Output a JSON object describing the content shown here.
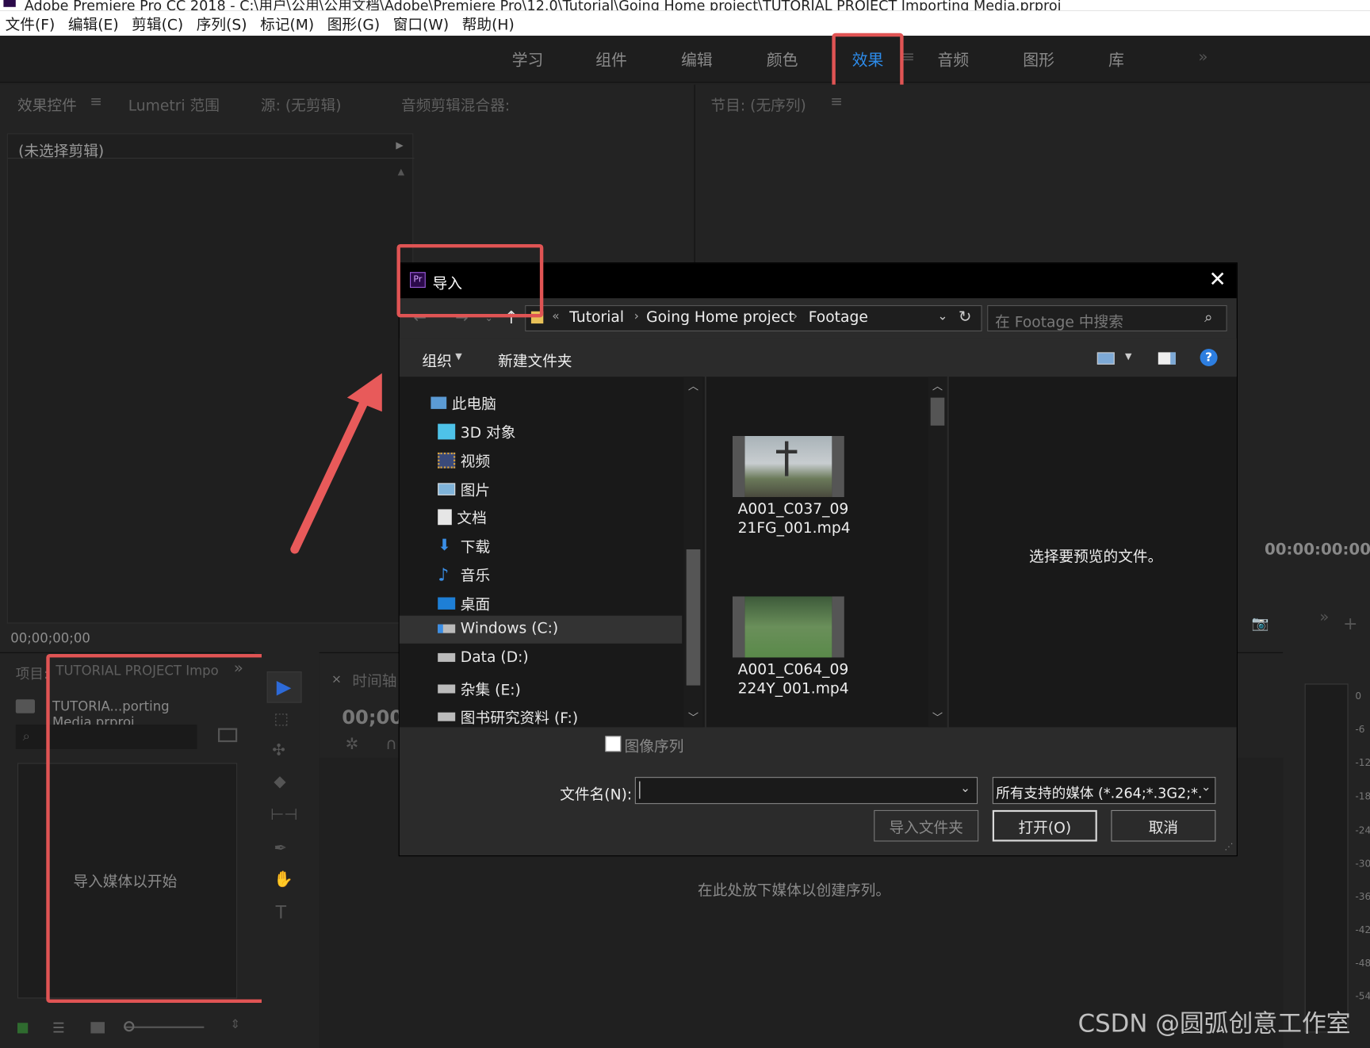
{
  "window": {
    "title": "Adobe Premiere Pro CC 2018 - C:\\用户\\公用\\公用文档\\Adobe\\Premiere Pro\\12.0\\Tutorial\\Going Home project\\TUTORIAL PROJECT Importing Media.prproj"
  },
  "menu": [
    "文件(F)",
    "编辑(E)",
    "剪辑(C)",
    "序列(S)",
    "标记(M)",
    "图形(G)",
    "窗口(W)",
    "帮助(H)"
  ],
  "workspaces": [
    "学习",
    "组件",
    "编辑",
    "颜色",
    "效果",
    "音频",
    "图形",
    "库"
  ],
  "workspaces_more": "»",
  "upper_left": {
    "tabs": [
      "效果控件",
      "Lumetri 范围",
      "源: (无剪辑)",
      "音频剪辑混合器:"
    ],
    "menu_glyph": "≡",
    "no_clip": "(未选择剪辑)",
    "timecode": "00;00;00;00"
  },
  "program": {
    "tab": "节目: (无序列)",
    "menu_glyph": "≡",
    "timecode": "00:00:00:00"
  },
  "project": {
    "tab_label": "项目:",
    "tab_title": "TUTORIAL PROJECT Impo",
    "file": "TUTORIA...porting Media.prproj",
    "empty": "导入媒体以开始"
  },
  "timeline": {
    "tab": "时间轴",
    "timecode": "00;00;",
    "drop_hint": "在此处放下媒体以创建序列。"
  },
  "meter_ticks": [
    "0",
    "-6",
    "-12",
    "-18",
    "-24",
    "-30",
    "-36",
    "-42",
    "-48",
    "-54"
  ],
  "dialog": {
    "app_badge": "Pr",
    "title": "导入",
    "breadcrumb": [
      "Tutorial",
      "Going Home project",
      "Footage"
    ],
    "search_placeholder": "在 Footage 中搜索",
    "organize": "组织",
    "new_folder": "新建文件夹",
    "help": "?",
    "nav": [
      {
        "label": "此电脑",
        "icon": "computer-icon"
      },
      {
        "label": "3D 对象",
        "icon": "cube-icon"
      },
      {
        "label": "视频",
        "icon": "video-icon"
      },
      {
        "label": "图片",
        "icon": "picture-icon"
      },
      {
        "label": "文档",
        "icon": "document-icon"
      },
      {
        "label": "下载",
        "icon": "download-icon"
      },
      {
        "label": "音乐",
        "icon": "music-icon"
      },
      {
        "label": "桌面",
        "icon": "desktop-icon"
      },
      {
        "label": "Windows (C:)",
        "icon": "drive-icon"
      },
      {
        "label": "Data (D:)",
        "icon": "drive-icon"
      },
      {
        "label": "杂集 (E:)",
        "icon": "drive-icon"
      },
      {
        "label": "图书研究资料 (F:)",
        "icon": "drive-icon"
      }
    ],
    "nav_selected": "Windows (C:)",
    "files": [
      {
        "line1": "A001_C037_09",
        "line2": "21FG_001.mp4"
      },
      {
        "line1": "A001_C064_09",
        "line2": "224Y_001.mp4"
      }
    ],
    "preview_text": "选择要预览的文件。",
    "image_sequence": "图像序列",
    "filename_label": "文件名(N):",
    "filename_value": "",
    "filter": "所有支持的媒体 (*.264;*.3G2;*.",
    "btn_import_folder": "导入文件夹",
    "btn_open": "打开(O)",
    "btn_cancel": "取消"
  },
  "watermark": "CSDN @圆弧创意工作室",
  "colors": {
    "highlight": "#e05454",
    "accent": "#2d8ceb",
    "arrow": "#e85a5a"
  }
}
